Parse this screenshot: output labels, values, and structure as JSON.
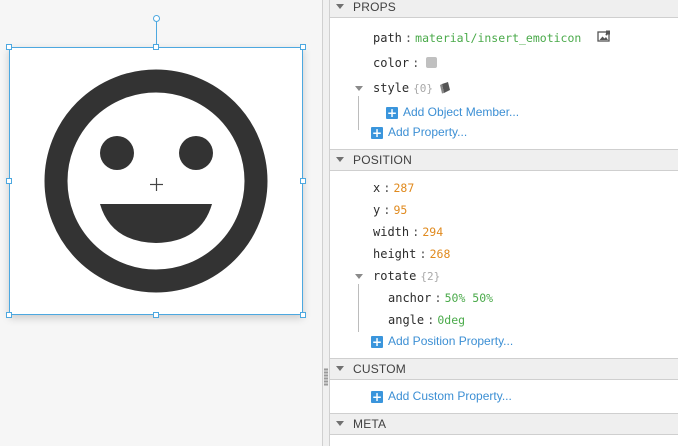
{
  "canvas": {
    "icon_color": "#333333"
  },
  "sections": {
    "props": "PROPS",
    "position": "POSITION",
    "custom": "CUSTOM",
    "meta": "META"
  },
  "props": {
    "path_key": "path",
    "path_value": "material/insert_emoticon",
    "color_key": "color",
    "color_value": "#c0c0c0",
    "style_key": "style",
    "style_count": "{0}",
    "add_object_member": "Add Object Member...",
    "add_property": "Add Property..."
  },
  "position": {
    "x_key": "x",
    "x_value": "287",
    "y_key": "y",
    "y_value": "95",
    "width_key": "width",
    "width_value": "294",
    "height_key": "height",
    "height_value": "268",
    "rotate_key": "rotate",
    "rotate_count": "{2}",
    "anchor_key": "anchor",
    "anchor_value": "50% 50%",
    "angle_key": "angle",
    "angle_value": "0deg",
    "add_position_property": "Add Position Property..."
  },
  "custom": {
    "add_custom_property": "Add Custom Property..."
  },
  "colors": {
    "selection": "#4da8e0",
    "string_value": "#4aaa4a",
    "number_value": "#e08a1e",
    "link": "#3c8fd4"
  }
}
